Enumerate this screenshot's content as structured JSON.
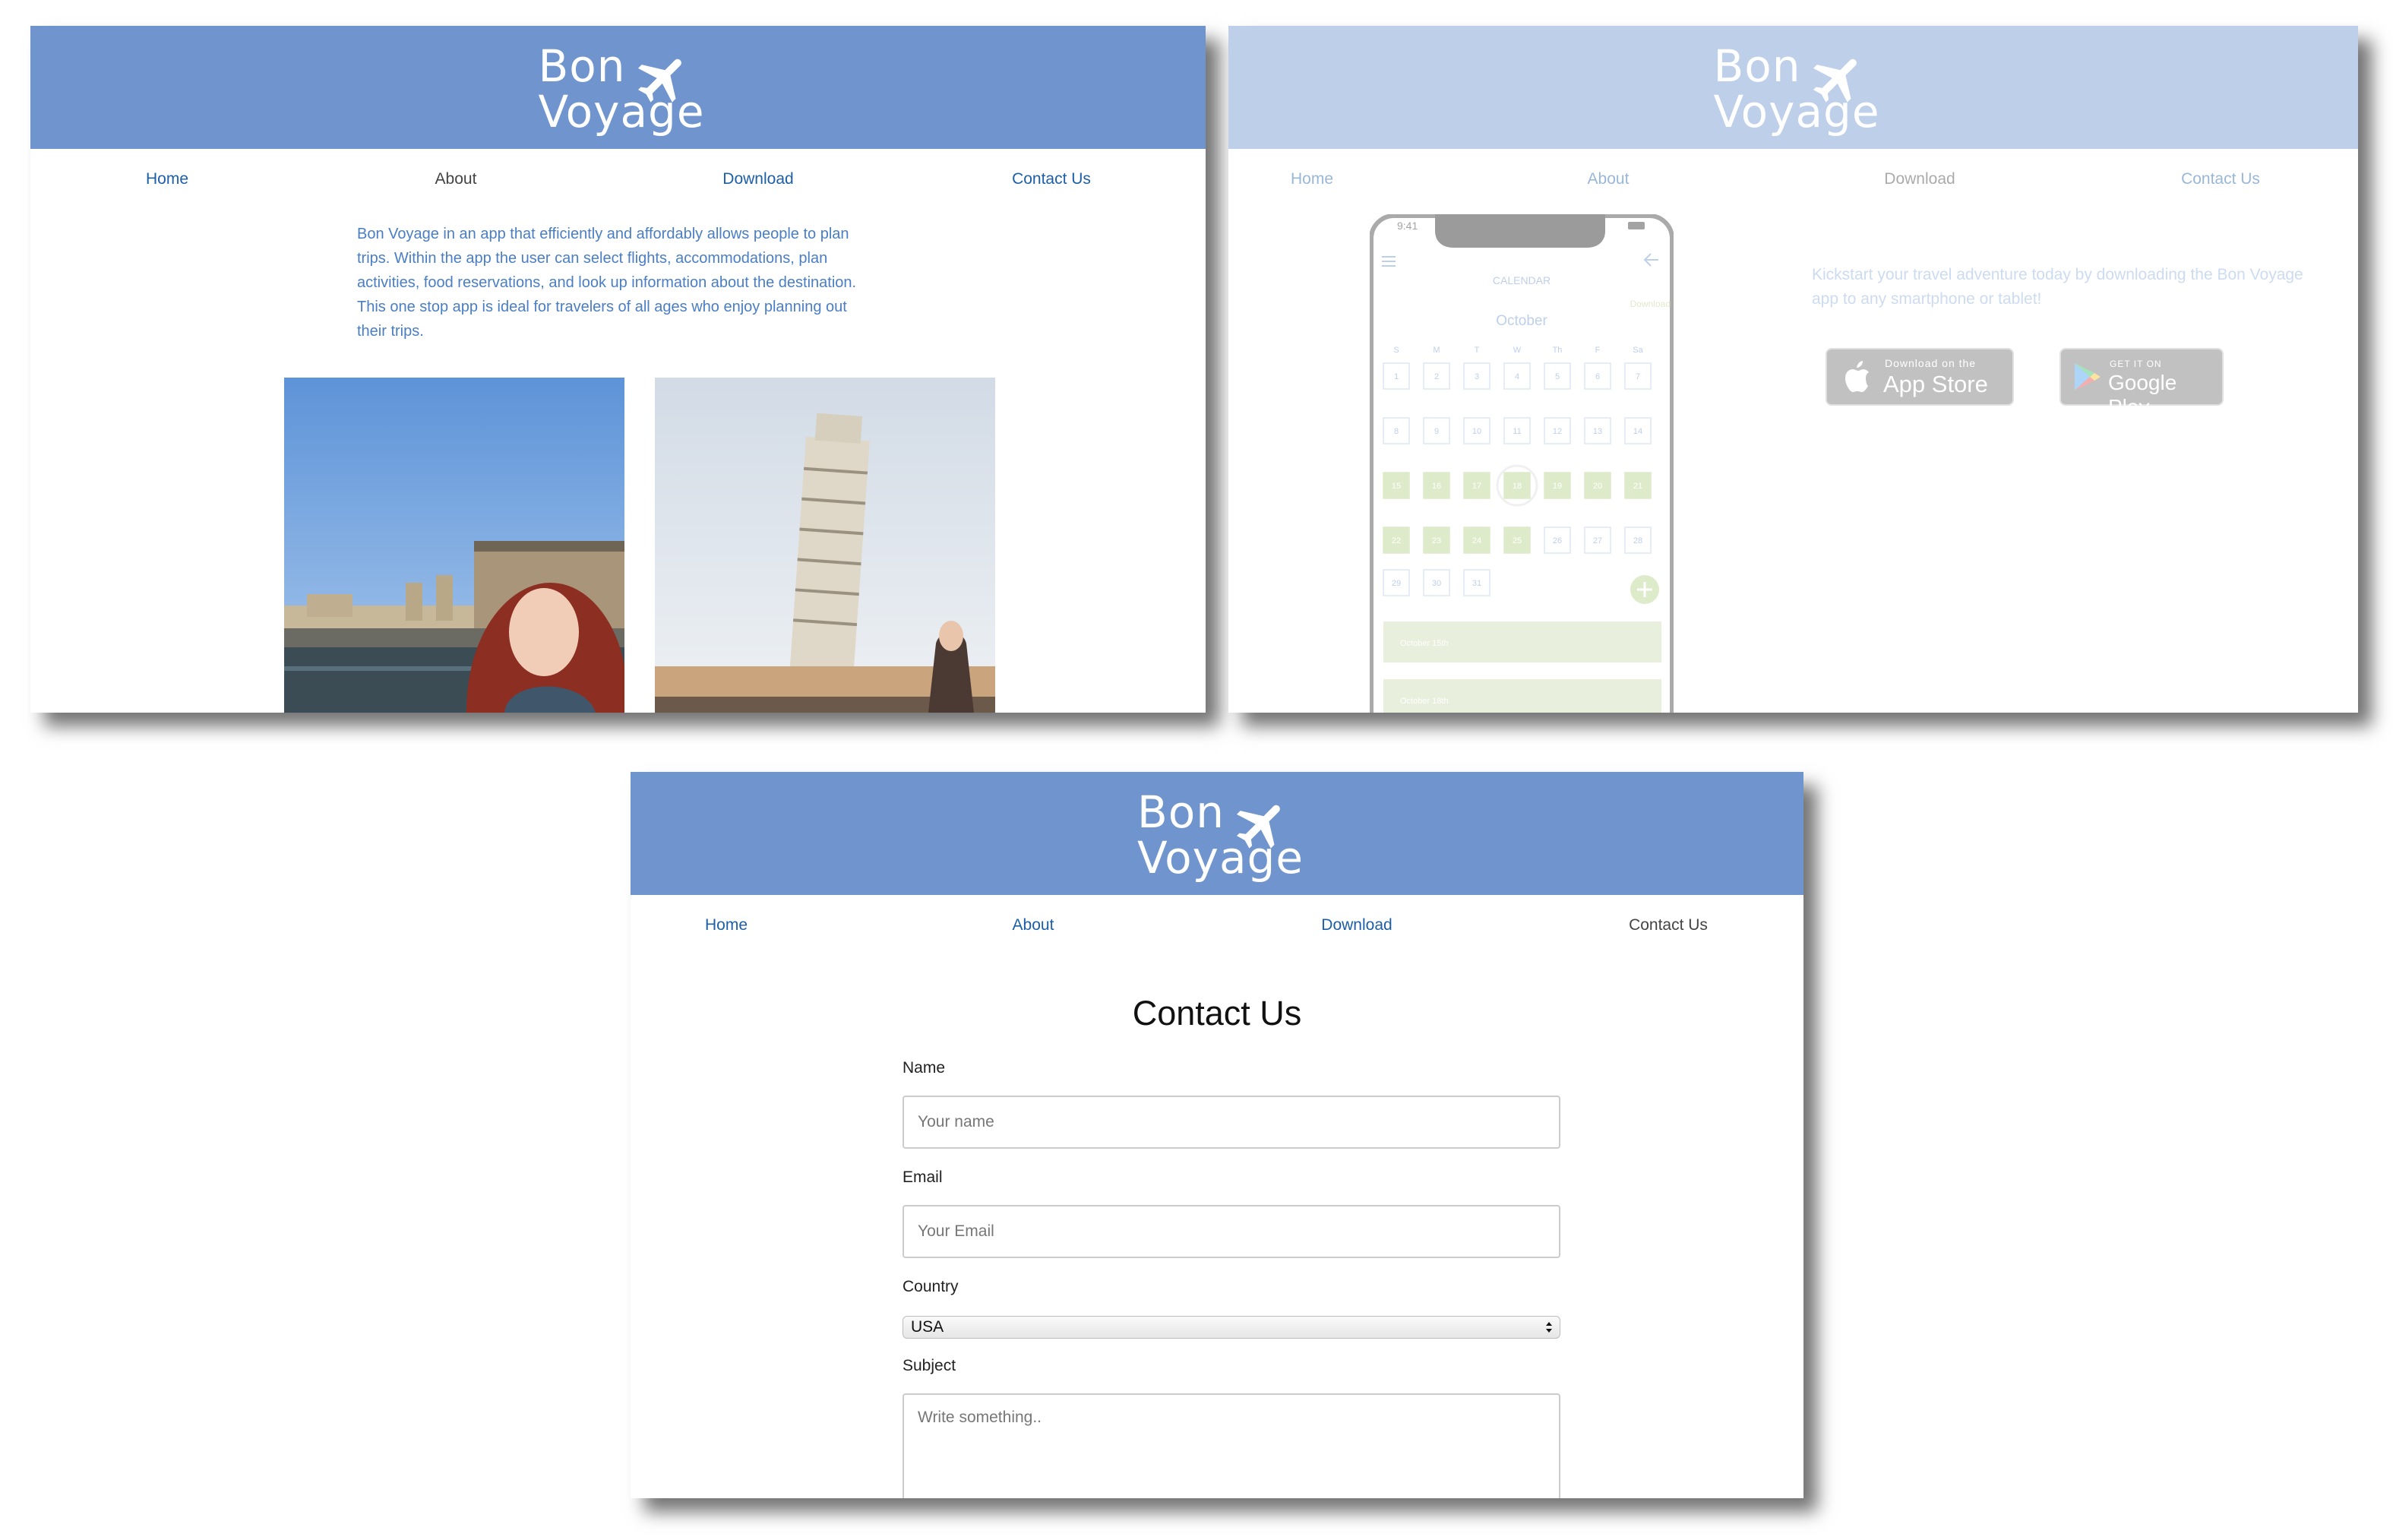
{
  "brand": {
    "line1": "Bon",
    "line2": "Voyage"
  },
  "nav": {
    "home": "Home",
    "about": "About",
    "download": "Download",
    "contact": "Contact Us"
  },
  "colors": {
    "header": "#7094ce",
    "link": "#1c5fa8",
    "calendar_green": "#cfdcb3"
  },
  "about": {
    "lines": [
      "Bon Voyage in an app that efficiently and affordably allows people to plan",
      "trips. Within the app the user can select flights, accommodations, plan",
      "activities, food reservations, and look up information about the destination.",
      "This one stop app is ideal for travelers of all ages who enjoy planning out",
      "their trips."
    ]
  },
  "download": {
    "lines": [
      "Kickstart your travel adventure today by downloading the Bon Voyage",
      "app to any smartphone or tablet!"
    ],
    "app_store": {
      "small": "Download on the",
      "big": "App Store"
    },
    "google_play": {
      "small": "GET IT ON",
      "big": "Google Play"
    },
    "phone": {
      "time": "9:41",
      "title": "CALENDAR",
      "download_label": "Download",
      "month": "October",
      "weekdays": [
        "S",
        "M",
        "T",
        "W",
        "Th",
        "F",
        "Sa"
      ],
      "weeks": [
        [
          "1",
          "2",
          "3",
          "4",
          "5",
          "6",
          "7"
        ],
        [
          "8",
          "9",
          "10",
          "11",
          "12",
          "13",
          "14"
        ],
        [
          "15",
          "16",
          "17",
          "18",
          "19",
          "20",
          "21"
        ],
        [
          "22",
          "23",
          "24",
          "25",
          "26",
          "27",
          "28"
        ],
        [
          "29",
          "30",
          "31"
        ]
      ],
      "highlighted_days": [
        15,
        16,
        17,
        18,
        19,
        20,
        21,
        22,
        23,
        24,
        25
      ],
      "selected_day": 18,
      "events": [
        "October 15th",
        "October 18th"
      ]
    }
  },
  "contact": {
    "title": "Contact Us",
    "name_label": "Name",
    "name_placeholder": "Your name",
    "email_label": "Email",
    "email_placeholder": "Your Email",
    "country_label": "Country",
    "country_value": "USA",
    "subject_label": "Subject",
    "subject_placeholder": "Write something.."
  }
}
